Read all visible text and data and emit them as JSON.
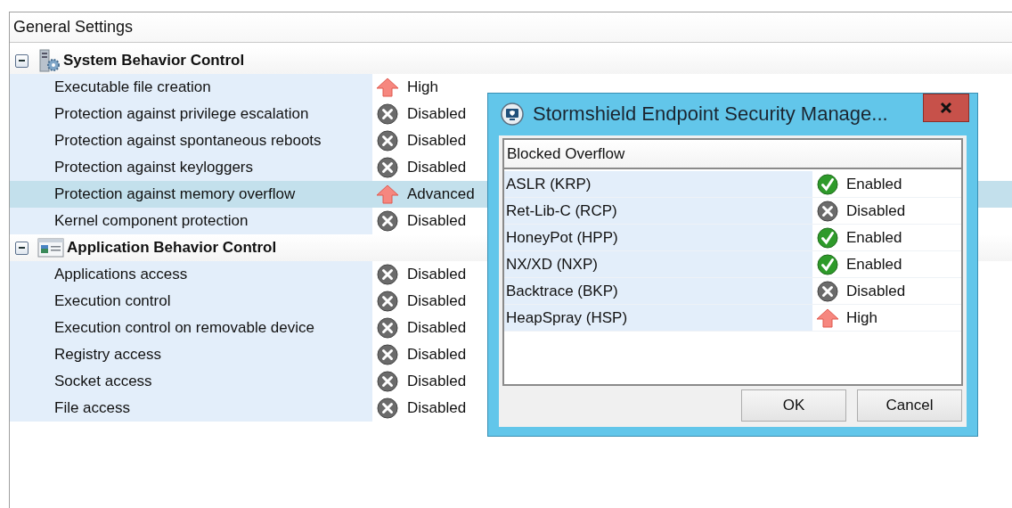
{
  "panel": {
    "title": "General Settings",
    "groups": [
      {
        "label": "System Behavior Control",
        "kind": "server",
        "expanded": true,
        "children": [
          {
            "label": "Executable file creation",
            "status": {
              "kind": "up",
              "text": "High"
            },
            "selected": false
          },
          {
            "label": "Protection against privilege escalation",
            "status": {
              "kind": "disabled",
              "text": "Disabled"
            },
            "selected": false
          },
          {
            "label": "Protection against spontaneous reboots",
            "status": {
              "kind": "disabled",
              "text": "Disabled"
            },
            "selected": false
          },
          {
            "label": "Protection against keyloggers",
            "status": {
              "kind": "disabled",
              "text": "Disabled"
            },
            "selected": false
          },
          {
            "label": "Protection against memory overflow",
            "status": {
              "kind": "up",
              "text": "Advanced"
            },
            "selected": true
          },
          {
            "label": "Kernel component protection",
            "status": {
              "kind": "disabled",
              "text": "Disabled"
            },
            "selected": false
          }
        ]
      },
      {
        "label": "Application Behavior Control",
        "kind": "window",
        "expanded": true,
        "children": [
          {
            "label": "Applications access",
            "status": {
              "kind": "disabled",
              "text": "Disabled"
            },
            "selected": false
          },
          {
            "label": "Execution control",
            "status": {
              "kind": "disabled",
              "text": "Disabled"
            },
            "selected": false
          },
          {
            "label": "Execution control on removable device",
            "status": {
              "kind": "disabled",
              "text": "Disabled"
            },
            "selected": false
          },
          {
            "label": "Registry access",
            "status": {
              "kind": "disabled",
              "text": "Disabled"
            },
            "selected": false
          },
          {
            "label": "Socket access",
            "status": {
              "kind": "disabled",
              "text": "Disabled"
            },
            "selected": false
          },
          {
            "label": "File access",
            "status": {
              "kind": "disabled",
              "text": "Disabled"
            },
            "selected": false
          }
        ]
      }
    ]
  },
  "dialog": {
    "title": "Stormshield Endpoint Security Manage...",
    "list": {
      "column": "Blocked Overflow",
      "rows": [
        {
          "label": "ASLR (KRP)",
          "status": {
            "kind": "enabled",
            "text": "Enabled"
          }
        },
        {
          "label": "Ret-Lib-C (RCP)",
          "status": {
            "kind": "disabled",
            "text": "Disabled"
          }
        },
        {
          "label": "HoneyPot (HPP)",
          "status": {
            "kind": "enabled",
            "text": "Enabled"
          }
        },
        {
          "label": "NX/XD (NXP)",
          "status": {
            "kind": "enabled",
            "text": "Enabled"
          }
        },
        {
          "label": "Backtrace (BKP)",
          "status": {
            "kind": "disabled",
            "text": "Disabled"
          }
        },
        {
          "label": "HeapSpray (HSP)",
          "status": {
            "kind": "up",
            "text": "High"
          }
        }
      ]
    },
    "buttons": [
      "OK",
      "Cancel"
    ]
  }
}
